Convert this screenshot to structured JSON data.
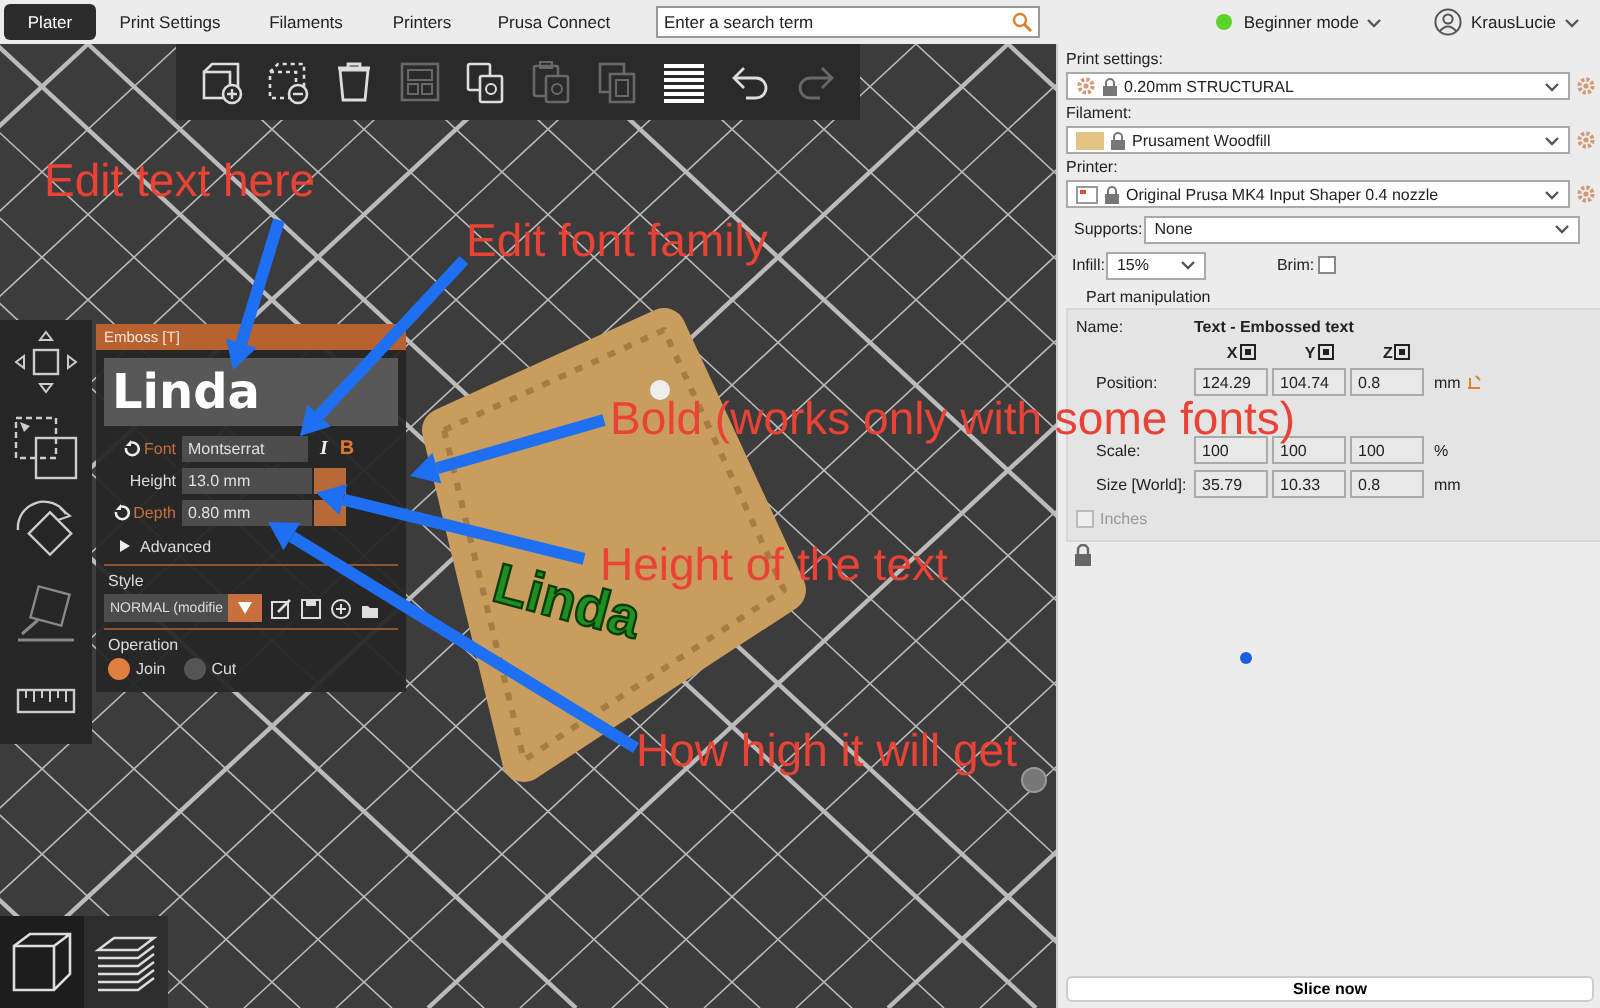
{
  "tabs": [
    {
      "label": "Plater",
      "selected": true
    },
    {
      "label": "Print Settings",
      "selected": false
    },
    {
      "label": "Filaments",
      "selected": false
    },
    {
      "label": "Printers",
      "selected": false
    },
    {
      "label": "Prusa Connect",
      "selected": false
    }
  ],
  "search": {
    "placeholder": "Enter a search term"
  },
  "mode": {
    "label": "Beginner mode"
  },
  "account": {
    "name": "KrausLucie"
  },
  "toolbar": [
    {
      "disabled": false
    },
    {
      "disabled": false
    },
    {
      "disabled": false
    },
    {
      "disabled": true
    },
    {
      "disabled": false
    },
    {
      "disabled": true
    },
    {
      "disabled": true
    },
    {
      "disabled": false
    },
    {
      "disabled": false
    },
    {
      "disabled": true
    }
  ],
  "view_buttons": [
    {
      "selected": true
    },
    {
      "selected": false
    }
  ],
  "scene": {
    "plate_text": "Linda"
  },
  "emboss_panel": {
    "title": "Emboss [T]",
    "text": "Linda",
    "rows": [
      {
        "label": "Font",
        "value": "Montserrat",
        "modified": true
      },
      {
        "label": "Height",
        "value": "13.0 mm",
        "modified": false
      },
      {
        "label": "Depth",
        "value": "0.80 mm",
        "modified": true
      }
    ],
    "style_buttons": [
      {
        "glyph": "I",
        "on": false
      },
      {
        "glyph": "B",
        "on": true
      }
    ],
    "advanced": {
      "label": "Advanced",
      "expanded": false
    },
    "style": {
      "label": "Style",
      "value": "NORMAL (modifie"
    },
    "operation": {
      "label": "Operation",
      "options": [
        {
          "label": "Join",
          "selected": true
        },
        {
          "label": "Cut",
          "selected": false
        }
      ]
    }
  },
  "sidebar": {
    "print_settings": {
      "label": "Print settings:",
      "value": "0.20mm STRUCTURAL"
    },
    "filament": {
      "label": "Filament:",
      "value": "Prusament Woodfill"
    },
    "printer": {
      "label": "Printer:",
      "value": "Original Prusa MK4 Input Shaper 0.4 nozzle"
    },
    "supports": {
      "label": "Supports:",
      "value": "None"
    },
    "infill": {
      "label": "Infill:",
      "value": "15%"
    },
    "brim": {
      "label": "Brim:",
      "checked": false
    },
    "part_manipulation": {
      "title": "Part manipulation",
      "name_label": "Name:",
      "name_value": "Text - Embossed text",
      "axes": [
        "X",
        "Y",
        "Z"
      ],
      "rows": [
        {
          "label": "Position:",
          "values": [
            "124.29",
            "104.74",
            "0.8"
          ],
          "unit": "mm"
        },
        {
          "label": "Scale:",
          "values": [
            "100",
            "100",
            "100"
          ],
          "unit": "%"
        },
        {
          "label": "Size [World]:",
          "values": [
            "35.79",
            "10.33",
            "0.8"
          ],
          "unit": "mm"
        }
      ],
      "inches": {
        "label": "Inches",
        "checked": false,
        "disabled": true
      }
    },
    "slice_button": "Slice now"
  },
  "annotations": [
    {
      "text": "Edit text here"
    },
    {
      "text": "Edit font family"
    },
    {
      "text": "Bold (works only with some fonts)"
    },
    {
      "text": "Height of the text"
    },
    {
      "text": "How high it will get"
    }
  ]
}
